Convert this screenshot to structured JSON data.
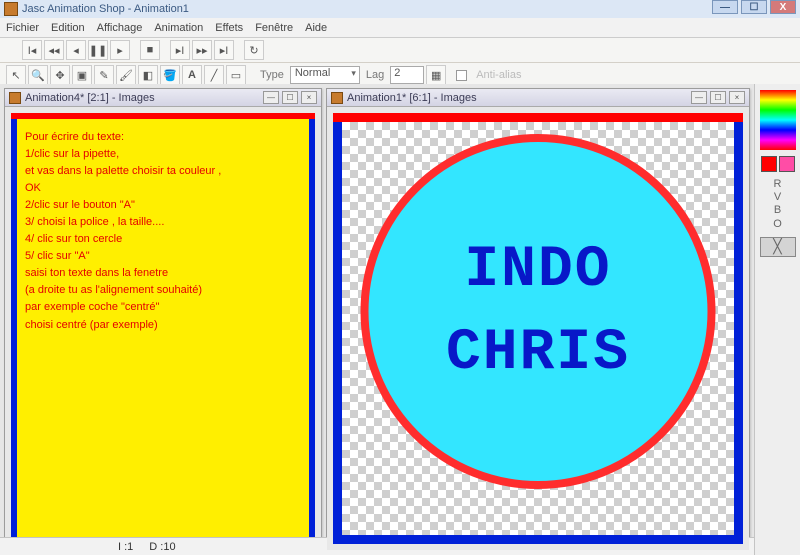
{
  "app": {
    "title": "Jasc Animation Shop - Animation1"
  },
  "menu": {
    "items": [
      "Fichier",
      "Edition",
      "Affichage",
      "Animation",
      "Effets",
      "Fenêtre",
      "Aide"
    ]
  },
  "toolbar2": {
    "typeLabel": "Type",
    "typeValue": "Normal",
    "lagLabel": "Lag",
    "lagValue": "2",
    "antialias": "Anti-alias"
  },
  "windows": {
    "left": {
      "title": "Animation4* [2:1] - Images"
    },
    "right": {
      "title": "Animation1* [6:1] - Images"
    }
  },
  "instructions": {
    "lines": [
      "Pour écrire du texte:",
      "1/clic  sur la pipette,",
      " et vas dans la palette choisir ta couleur ,",
      " OK",
      "2/clic sur le bouton \"A\"",
      "3/ choisi la police , la taille....",
      "4/ clic sur ton cercle",
      "5/ clic sur \"A\"",
      "saisi ton texte dans la fenetre",
      "(a droite tu as l'alignement souhaité)",
      "par exemple coche \"centré\"",
      "choisi centré (par exemple)"
    ]
  },
  "circle": {
    "line1": "INDO",
    "line2": "CHRIS"
  },
  "status": {
    "i": "I :1",
    "d": "D :10"
  },
  "palette": {
    "swatch1": "#ff0000",
    "swatch2": "#ff4da6",
    "rvbo": [
      "R",
      "V",
      "B",
      "O"
    ]
  }
}
